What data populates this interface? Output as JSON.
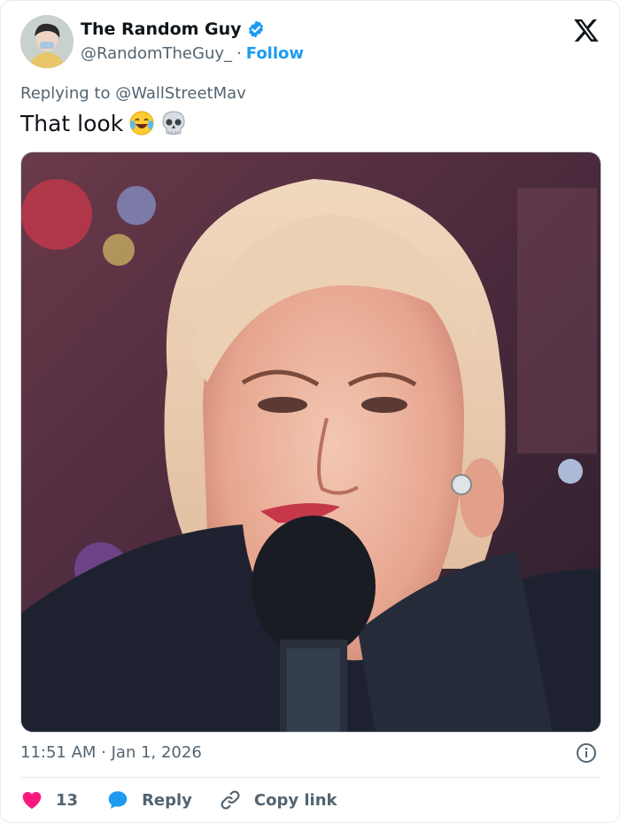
{
  "author": {
    "display_name": "The Random Guy",
    "handle": "@RandomTheGuy_",
    "follow_label": "Follow",
    "separator": "·"
  },
  "tweet": {
    "reply_prefix": "Replying to",
    "reply_handle": "@WallStreetMav",
    "text": "That look",
    "emojis": [
      "joy-emoji",
      "skull-emoji"
    ],
    "timestamp": "11:51 AM · Jan 1, 2026"
  },
  "actions": {
    "like_count": "13",
    "reply_label": "Reply",
    "copy_label": "Copy link"
  },
  "colors": {
    "accent": "#1d9bf0",
    "like": "#f91880",
    "muted": "#536471",
    "text": "#0f1419"
  }
}
